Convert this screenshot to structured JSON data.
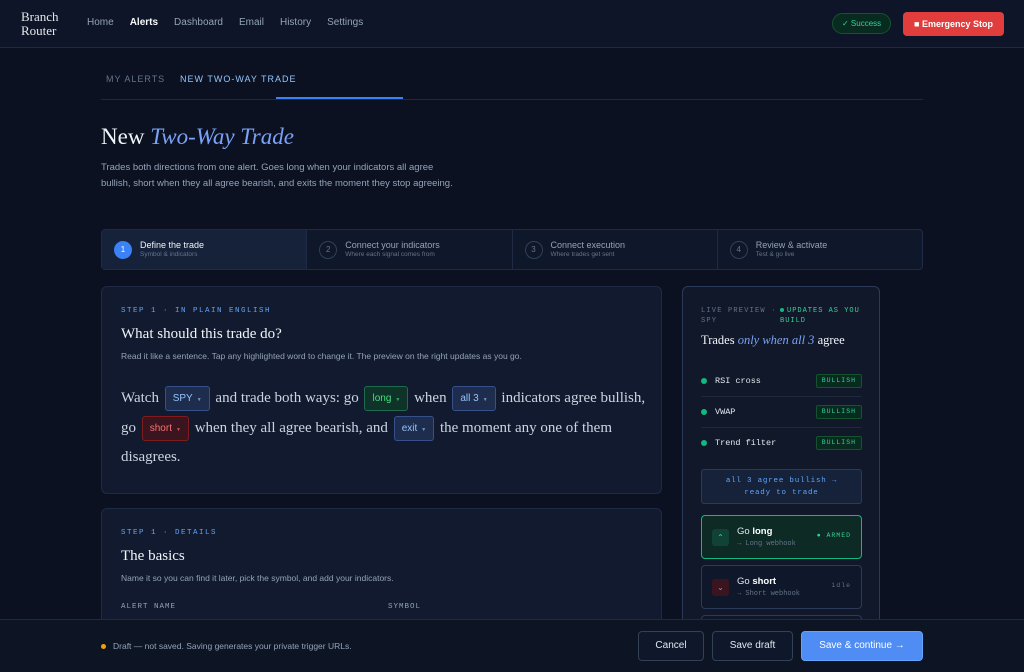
{
  "app": {
    "name": "Branch Router"
  },
  "nav": {
    "items": [
      "Home",
      "Alerts",
      "Dashboard",
      "Email",
      "History",
      "Settings"
    ],
    "active": "Alerts"
  },
  "status": {
    "success": "✓ Success",
    "emergency": "■ Emergency Stop"
  },
  "tabs": [
    "MY ALERTS",
    "NEW TWO-WAY TRADE"
  ],
  "page": {
    "title_prefix": "New",
    "title_em": "Two-Way Trade",
    "description": "Trades both directions from one alert. Goes long when your indicators all agree bullish, short when they all agree bearish, and exits the moment they stop agreeing."
  },
  "steps": [
    {
      "num": "1",
      "title": "Define the trade",
      "sub": "Symbol & indicators"
    },
    {
      "num": "2",
      "title": "Connect your indicators",
      "sub": "Where each signal comes from"
    },
    {
      "num": "3",
      "title": "Connect execution",
      "sub": "Where trades get sent"
    },
    {
      "num": "4",
      "title": "Review & activate",
      "sub": "Test & go live"
    }
  ],
  "card1": {
    "eyebrow": "STEP 1 · IN PLAIN ENGLISH",
    "title": "What should this trade do?",
    "sub": "Read it like a sentence. Tap any highlighted word to change it. The preview on the right updates as you go.",
    "sentence": {
      "t1": "Watch",
      "symbol": "SPY",
      "t2": "and trade both ways: go",
      "long": "long",
      "t3": "when",
      "count": "all 3",
      "t4": "indicators agree bullish,",
      "t5": "go",
      "short": "short",
      "t6": "when they all agree bearish, and",
      "exit": "exit",
      "t7": "the moment any one of them disagrees."
    }
  },
  "card2": {
    "eyebrow": "STEP 1 · DETAILS",
    "title": "The basics",
    "sub": "Name it so you can find it later, pick the symbol, and add your indicators.",
    "field1": "ALERT NAME",
    "field2": "SYMBOL"
  },
  "preview": {
    "eyebrow": "LIVE PREVIEW · SPY",
    "updates": "UPDATES AS YOU BUILD",
    "title_a": "Trades",
    "title_em": "only when all 3",
    "title_b": "agree",
    "indicators": [
      {
        "name": "RSI cross",
        "badge": "BULLISH"
      },
      {
        "name": "VWAP",
        "badge": "BULLISH"
      },
      {
        "name": "Trend filter",
        "badge": "BULLISH"
      }
    ],
    "agree_line1": "all 3 agree bullish →",
    "agree_line2": "ready to trade",
    "long": {
      "go": "Go",
      "word": "long",
      "sub": "→ Long webhook",
      "status": "● ARMED"
    },
    "short": {
      "go": "Go",
      "word": "short",
      "sub": "→ Short webhook",
      "status": "idle"
    }
  },
  "footer": {
    "draft": "Draft — not saved. Saving generates your private trigger URLs.",
    "cancel": "Cancel",
    "save": "Save draft",
    "continue": "Save & continue →"
  },
  "colors": {
    "accent": "#3b82f6",
    "success": "#10b981",
    "danger": "#e23d3d",
    "background": "#0b1120"
  }
}
